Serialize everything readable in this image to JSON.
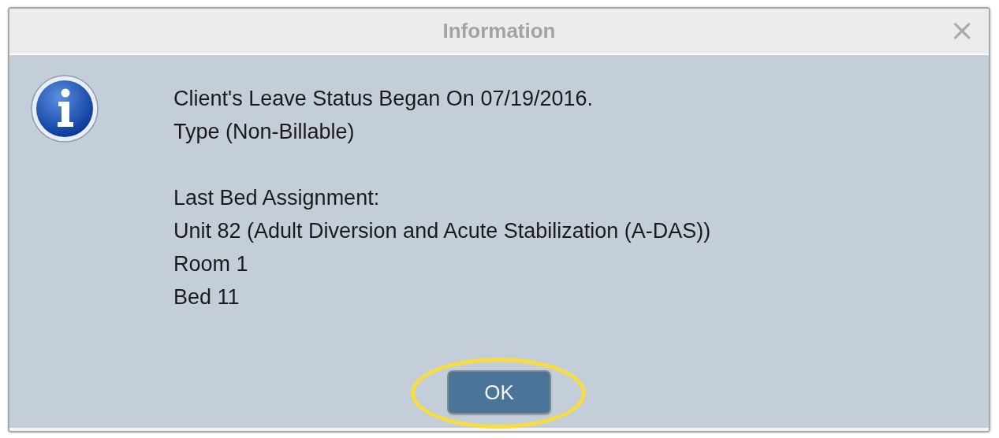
{
  "window": {
    "title": "Information",
    "close": "×"
  },
  "message": {
    "paragraphs": [
      [
        "Client's Leave Status Began On 07/19/2016.",
        "Type (Non-Billable)"
      ],
      [
        "Last Bed Assignment:",
        "Unit 82 (Adult Diversion and Acute Stabilization (A-DAS))",
        "Room 1",
        "Bed 11"
      ]
    ]
  },
  "buttons": [
    {
      "label": "OK",
      "highlighted": true
    }
  ]
}
